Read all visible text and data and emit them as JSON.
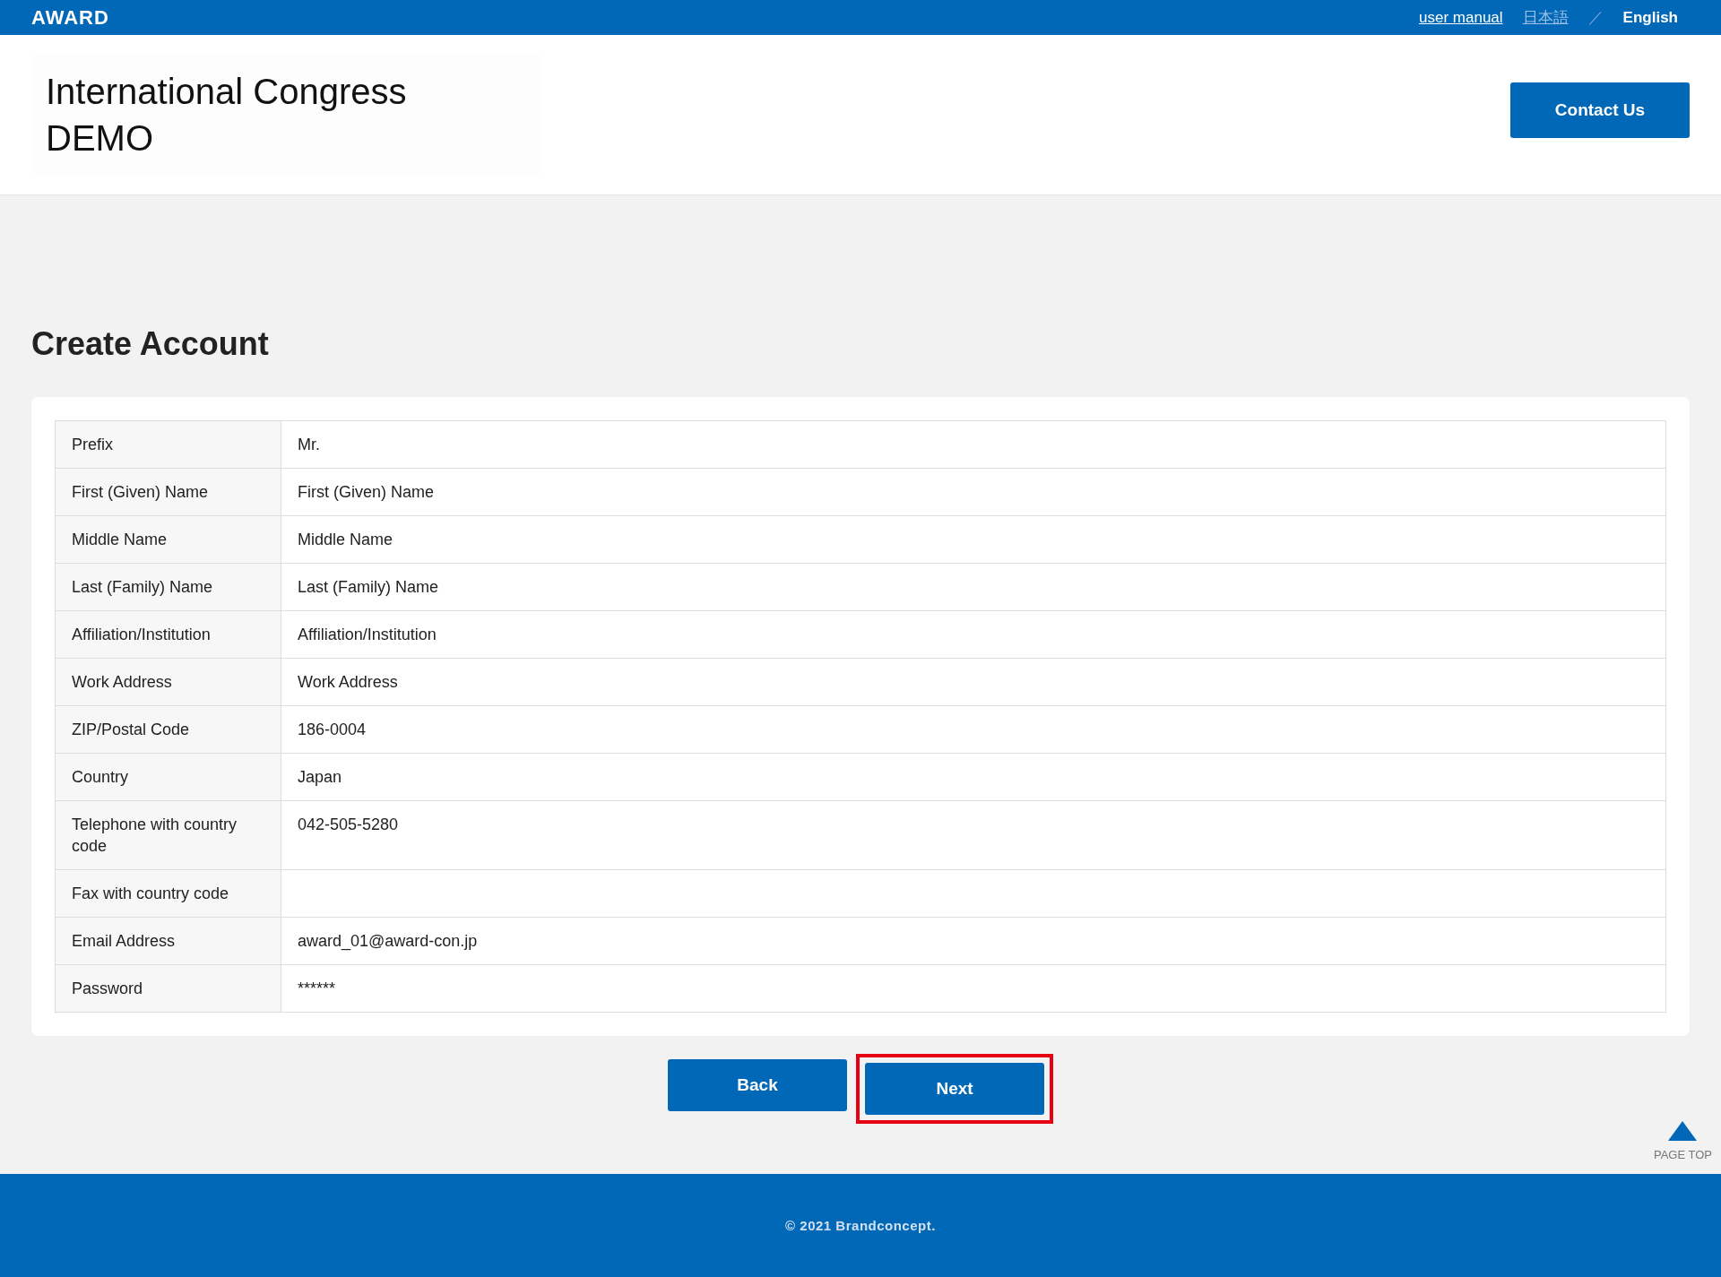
{
  "topbar": {
    "logo": "AWARD",
    "manual_link": "user manual",
    "languages": [
      {
        "label": "日本語",
        "selected": false
      },
      {
        "label": "English",
        "selected": true
      }
    ],
    "separator": "／"
  },
  "header": {
    "title_lines": [
      "International Congress",
      "DEMO"
    ],
    "contact_button": "Contact Us"
  },
  "page_title": "Create Account",
  "form": {
    "rows": [
      {
        "label": "Prefix",
        "value": "Mr."
      },
      {
        "label": "First (Given) Name",
        "value": "First (Given) Name"
      },
      {
        "label": "Middle Name",
        "value": "Middle Name"
      },
      {
        "label": "Last (Family) Name",
        "value": "Last (Family) Name"
      },
      {
        "label": "Affiliation/Institution",
        "value": "Affiliation/Institution"
      },
      {
        "label": "Work Address",
        "value": "Work Address"
      },
      {
        "label": "ZIP/Postal Code",
        "value": "186-0004"
      },
      {
        "label": "Country",
        "value": "Japan"
      },
      {
        "label": "Telephone with country code",
        "value": "042-505-5280"
      },
      {
        "label": "Fax with country code",
        "value": ""
      },
      {
        "label": "Email Address",
        "value": "award_01@award-con.jp"
      },
      {
        "label": "Password",
        "value": "******"
      }
    ]
  },
  "actions": [
    {
      "label": "Back",
      "highlighted": false
    },
    {
      "label": "Next",
      "highlighted": true
    }
  ],
  "page_top": "PAGE TOP",
  "footer": "© 2021 Brandconcept."
}
